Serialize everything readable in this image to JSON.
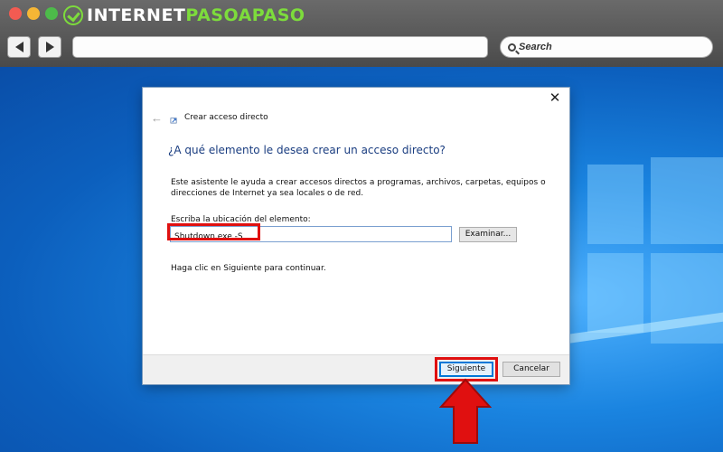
{
  "browser": {
    "logo_prefix": "INTERNET",
    "logo_accent": "PASOAPASO",
    "search_label": "Search"
  },
  "dialog": {
    "title": "Crear acceso directo",
    "heading": "¿A qué elemento le desea crear un acceso directo?",
    "description": "Este asistente le ayuda a crear accesos directos a programas, archivos, carpetas, equipos o direcciones de Internet ya sea locales o de red.",
    "field_label": "Escriba la ubicación del elemento:",
    "field_value": "Shutdown.exe -S",
    "browse_label": "Examinar...",
    "hint": "Haga clic en Siguiente para continuar.",
    "next_label": "Siguiente",
    "cancel_label": "Cancelar",
    "close_glyph": "✕",
    "back_glyph": "←"
  },
  "colors": {
    "annotation_red": "#e01010",
    "heading_blue": "#1a3d80",
    "logo_green": "#7ddc3c"
  },
  "icons": [
    "back-arrow-icon",
    "forward-arrow-icon",
    "search-icon",
    "shortcut-icon",
    "close-icon",
    "annotation-arrow-icon"
  ]
}
